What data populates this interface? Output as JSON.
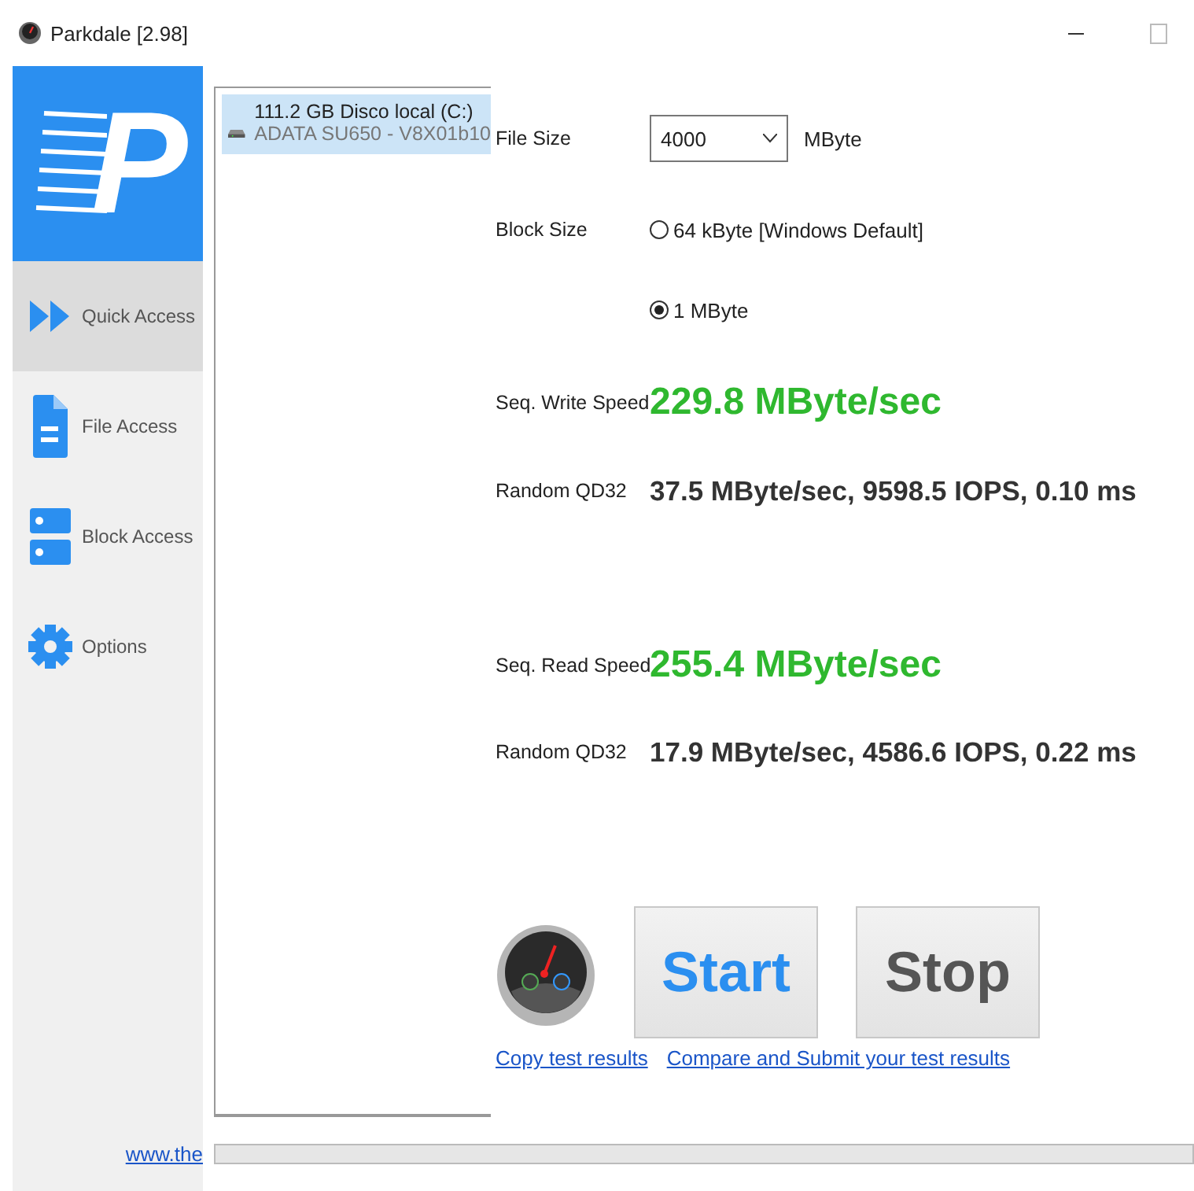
{
  "window": {
    "title": "Parkdale [2.98]"
  },
  "logo": {
    "letter": "P"
  },
  "sidebar": {
    "items": [
      {
        "label": "Quick Access",
        "kind": "quick",
        "selected": true
      },
      {
        "label": "File Access",
        "kind": "file",
        "selected": false
      },
      {
        "label": "Block Access",
        "kind": "block",
        "selected": false
      },
      {
        "label": "Options",
        "kind": "options",
        "selected": false
      }
    ],
    "link": "www.the"
  },
  "drives": [
    {
      "name": "111.2 GB Disco local (C:)",
      "model": "ADATA SU650 - V8X01b10",
      "selected": true
    }
  ],
  "file_size": {
    "label": "File Size",
    "value": "4000",
    "unit": "MByte"
  },
  "block_size": {
    "label": "Block Size",
    "options": [
      {
        "label": "64 kByte [Windows Default]",
        "selected": false
      },
      {
        "label": "1 MByte",
        "selected": true
      }
    ]
  },
  "results": [
    {
      "label": "Seq. Write Speed",
      "value": "229.8 MByte/sec",
      "kind": "seq"
    },
    {
      "label": "Random QD32",
      "value": "37.5 MByte/sec, 9598.5 IOPS, 0.10 ms",
      "kind": "random"
    },
    {
      "label": "Seq. Read Speed",
      "value": "255.4 MByte/sec",
      "kind": "seq"
    },
    {
      "label": "Random QD32",
      "value": "17.9 MByte/sec, 4586.6 IOPS, 0.22 ms",
      "kind": "random"
    }
  ],
  "buttons": [
    {
      "label": "Start",
      "kind": "primary"
    },
    {
      "label": "Stop",
      "kind": "secondary"
    }
  ],
  "links": [
    "Copy test results",
    "Compare and Submit your test results"
  ]
}
